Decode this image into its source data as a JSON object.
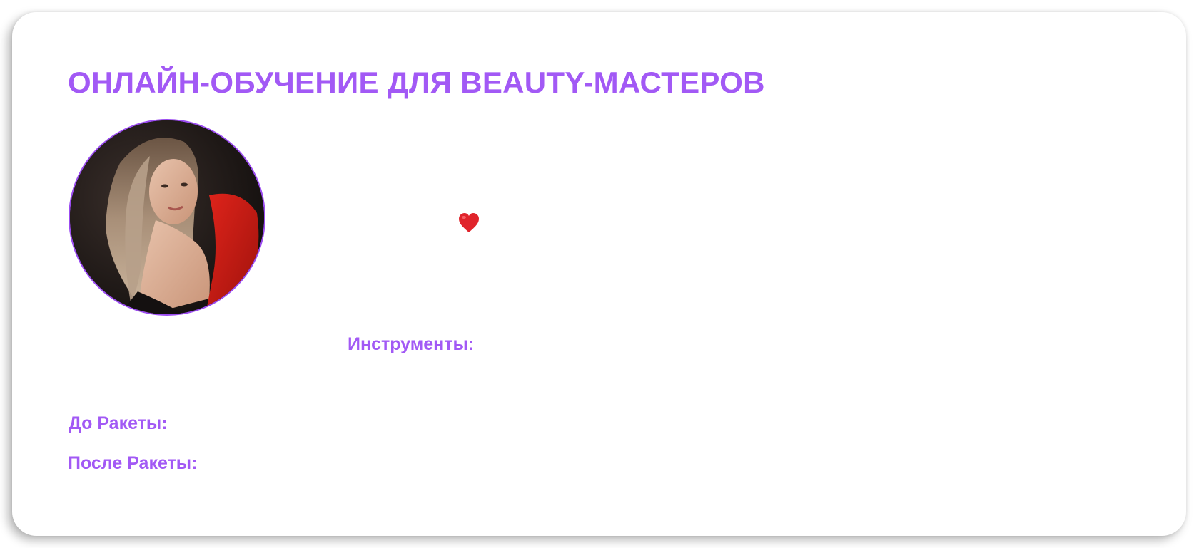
{
  "header": {
    "title": "ОНЛАЙН-ОБУЧЕНИЕ ДЛЯ BEAUTY-МАСТЕРОВ"
  },
  "profile": {
    "avatar_icon": "portrait-photo",
    "border_color": "#9b4cf0"
  },
  "decor": {
    "heart_icon": "red-heart-icon"
  },
  "sections": {
    "tools_label": "Инструменты:",
    "before_label": "До Ракеты:",
    "after_label": "После Ракеты:"
  },
  "colors": {
    "accent": "#a259f5",
    "heart": "#e0242b"
  }
}
